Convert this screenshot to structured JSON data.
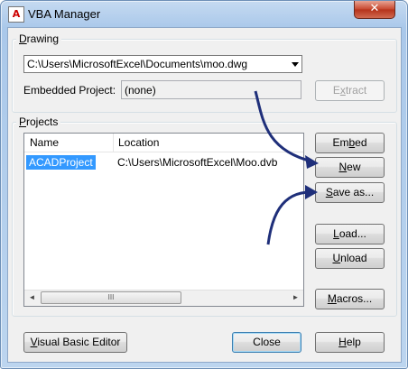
{
  "window": {
    "title": "VBA Manager",
    "app_icon": "autocad-icon",
    "close_glyph": "✕"
  },
  "drawing": {
    "group_label_prefix": "",
    "group_label_mnemonic": "D",
    "group_label_rest": "rawing",
    "selected_drawing": "C:\\Users\\MicrosoftExcel\\Documents\\moo.dwg",
    "embedded_label": "Embedded Project:",
    "embedded_value": "(none)",
    "extract_prefix": "E",
    "extract_mnemonic": "x",
    "extract_rest": "tract"
  },
  "projects": {
    "group_label_prefix": "",
    "group_label_mnemonic": "P",
    "group_label_rest": "rojects",
    "columns": [
      "Name",
      "Location"
    ],
    "rows": [
      {
        "name": "ACADProject",
        "location": "C:\\Users\\MicrosoftExcel\\Moo.dvb",
        "selected": true
      }
    ],
    "scroll_left_glyph": "◄",
    "scroll_thumb_grip": "III",
    "scroll_right_glyph": "►"
  },
  "buttons": {
    "embed": {
      "prefix": "Em",
      "mnemonic": "b",
      "rest": "ed"
    },
    "new": {
      "prefix": "",
      "mnemonic": "N",
      "rest": "ew"
    },
    "save_as": {
      "prefix": "",
      "mnemonic": "S",
      "rest": "ave as..."
    },
    "load": {
      "prefix": "",
      "mnemonic": "L",
      "rest": "oad..."
    },
    "unload": {
      "prefix": "",
      "mnemonic": "U",
      "rest": "nload"
    },
    "macros": {
      "prefix": "",
      "mnemonic": "M",
      "rest": "acros..."
    },
    "vbe": {
      "prefix": "",
      "mnemonic": "V",
      "rest": "isual Basic Editor"
    },
    "close": {
      "label": "Close"
    },
    "help": {
      "prefix": "",
      "mnemonic": "H",
      "rest": "elp"
    }
  },
  "colors": {
    "arrow": "#1f2f7a",
    "selection": "#3399ff"
  }
}
